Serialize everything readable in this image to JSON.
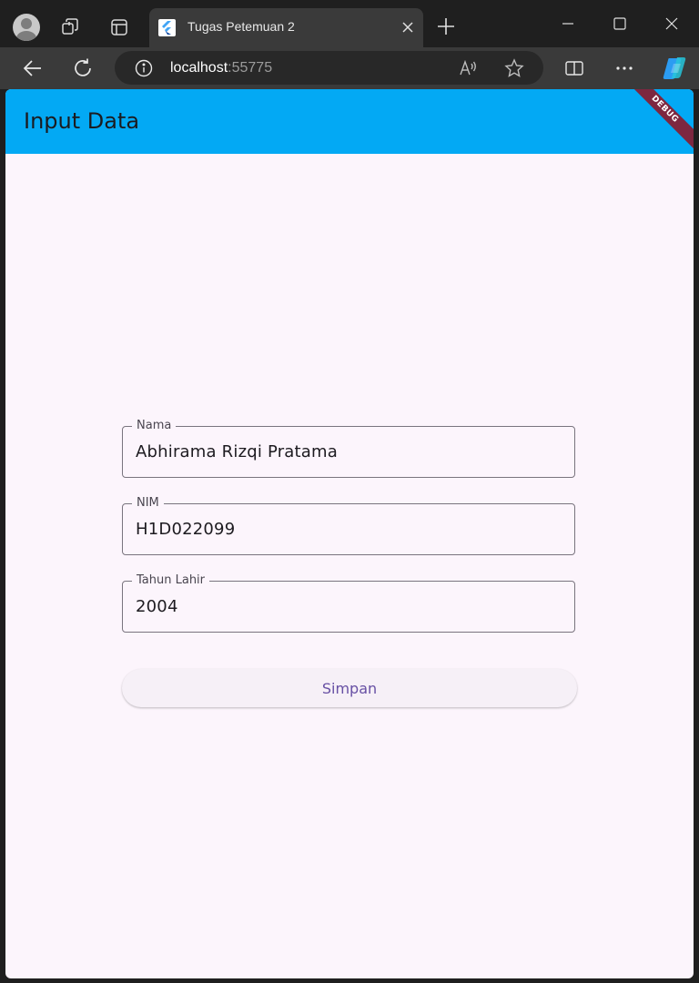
{
  "browser": {
    "tab": {
      "title": "Tugas Petemuan 2"
    },
    "address": {
      "host": "localhost",
      "port": ":55775"
    },
    "icons": {
      "profile": "avatar-icon",
      "workspaces": "workspaces-icon",
      "tab_actions": "tab-actions-icon",
      "favicon": "flutter-icon",
      "close_tab": "close-icon",
      "new_tab": "plus-icon",
      "minimize": "minimize-icon",
      "maximize": "maximize-icon",
      "close_window": "close-icon",
      "back": "back-arrow-icon",
      "refresh": "refresh-icon",
      "info": "info-icon",
      "read_aloud": "read-aloud-icon",
      "favorite": "star-icon",
      "split": "split-screen-icon",
      "more": "more-icon",
      "copilot": "copilot-icon"
    }
  },
  "app": {
    "title": "Input Data",
    "debug_banner": "DEBUG",
    "colors": {
      "appbar": "#03a9f4",
      "background": "#fcf5fc",
      "button_text": "#6750a4",
      "debug_banner": "#7d2740"
    },
    "form": {
      "fields": [
        {
          "label": "Nama",
          "value": "Abhirama Rizqi Pratama"
        },
        {
          "label": "NIM",
          "value": "H1D022099"
        },
        {
          "label": "Tahun Lahir",
          "value": "2004"
        }
      ],
      "submit_label": "Simpan"
    }
  }
}
